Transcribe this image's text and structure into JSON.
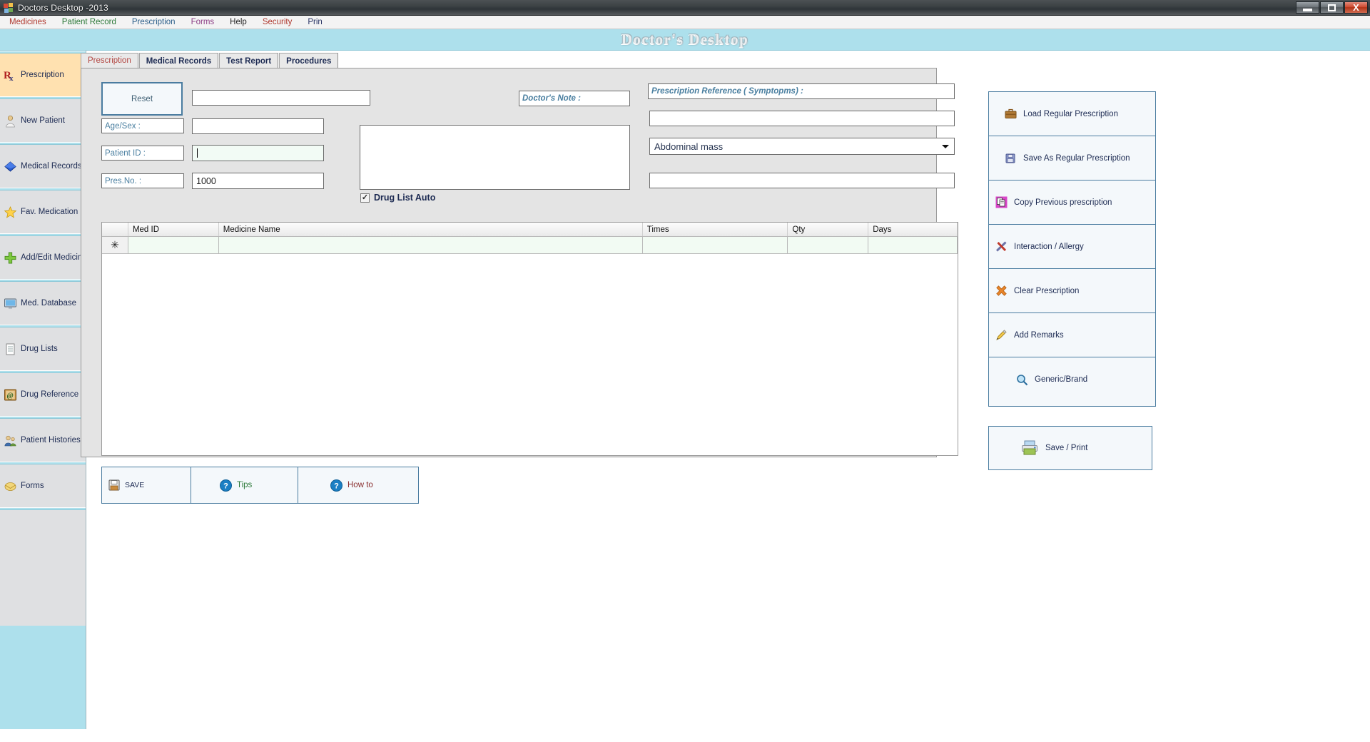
{
  "window": {
    "title": "Doctors Desktop -2013",
    "app_icon": "app-squares-icon",
    "minimize_label": "Minimize",
    "maximize_label": "Maximize",
    "close_label": "X"
  },
  "menubar": {
    "items": [
      {
        "label": "Medicines",
        "color": "#b0392f"
      },
      {
        "label": "Patient Record",
        "color": "#2d7a3a"
      },
      {
        "label": "Prescription",
        "color": "#2b5f8a"
      },
      {
        "label": "Forms",
        "color": "#8d3f86"
      },
      {
        "label": "Help",
        "color": "#222222"
      },
      {
        "label": "Security",
        "color": "#b0392f"
      },
      {
        "label": "Prin",
        "color": "#2a3566"
      }
    ]
  },
  "banner": {
    "title": "Doctor's Desktop",
    "bg": "#ade0ec"
  },
  "sidebar": {
    "items": [
      {
        "label": "Prescription",
        "icon": "rx-icon",
        "active": true
      },
      {
        "label": "New Patient",
        "icon": "patient-icon",
        "active": false
      },
      {
        "label": "Medical Records",
        "icon": "diamond-book-icon",
        "active": false
      },
      {
        "label": "Fav. Medication",
        "icon": "star-icon",
        "active": false
      },
      {
        "label": "Add/Edit Medicines",
        "icon": "plus-icon",
        "active": false
      },
      {
        "label": "Med. Database",
        "icon": "monitor-icon",
        "active": false
      },
      {
        "label": "Drug Lists",
        "icon": "list-icon",
        "active": false
      },
      {
        "label": "Drug Reference",
        "icon": "book-at-icon",
        "active": false
      },
      {
        "label": "Patient Histories",
        "icon": "people-icon",
        "active": false
      },
      {
        "label": "Forms",
        "icon": "envelope-icon",
        "active": false
      }
    ]
  },
  "tabs": [
    {
      "label": "Prescription",
      "active": true
    },
    {
      "label": "Medical Records",
      "active": false
    },
    {
      "label": "Test Report",
      "active": false
    },
    {
      "label": "Procedures",
      "active": false
    }
  ],
  "form": {
    "reset_button": "Reset",
    "name_value": "",
    "name_placeholder": "",
    "age_sex_label": "Age/Sex :",
    "age_sex_value": "",
    "patient_id_label": "Patient ID :",
    "patient_id_value": "",
    "pres_no_label": "Pres.No. :",
    "pres_no_value": "1000",
    "doctors_note_label": "Doctor's Note :",
    "doctors_note_value": "",
    "prescription_reference_label": "Prescription Reference ( Symptopms)  :",
    "symptom_text_value": "",
    "symptom_select_value": "Abdominal mass",
    "symptom_extra_value": "",
    "drug_list_auto_label": "Drug List Auto",
    "drug_list_auto_checked": "✓"
  },
  "grid": {
    "columns": [
      "Med ID",
      "Medicine Name",
      "Times",
      "Qty",
      "Days"
    ],
    "new_row_marker": "✳",
    "rows": []
  },
  "bottom_buttons": [
    {
      "label": "SAVE",
      "icon": "floppy-icon",
      "color": "#1c2a52"
    },
    {
      "label": "Tips",
      "icon": "help-icon",
      "color": "#2d7a3a"
    },
    {
      "label": "How to",
      "icon": "help-icon",
      "color": "#8a2f2f"
    }
  ],
  "right_panel": {
    "items": [
      {
        "label": "Load Regular Prescription",
        "icon": "briefcase-icon"
      },
      {
        "label": "Save As Regular Prescription",
        "icon": "save-icon"
      },
      {
        "label": "Copy  Previous prescription",
        "icon": "copy-icon"
      },
      {
        "label": "Interaction / Allergy",
        "icon": "interaction-icon"
      },
      {
        "label": "Clear Prescription",
        "icon": "clear-x-icon"
      },
      {
        "label": "Add Remarks",
        "icon": "pencil-icon"
      },
      {
        "label": "Generic/Brand",
        "icon": "magnifier-icon"
      }
    ],
    "save_print": {
      "label": "Save / Print",
      "icon": "printer-icon"
    }
  },
  "colors": {
    "banner_bg": "#ade0ec",
    "sidebar_bg": "#dfe0e2",
    "sidebar_active": "#ffe1b0",
    "panel_bg": "#e4e4e4",
    "accent_border": "#4a7ca0",
    "label_text": "#4a7fa0"
  }
}
